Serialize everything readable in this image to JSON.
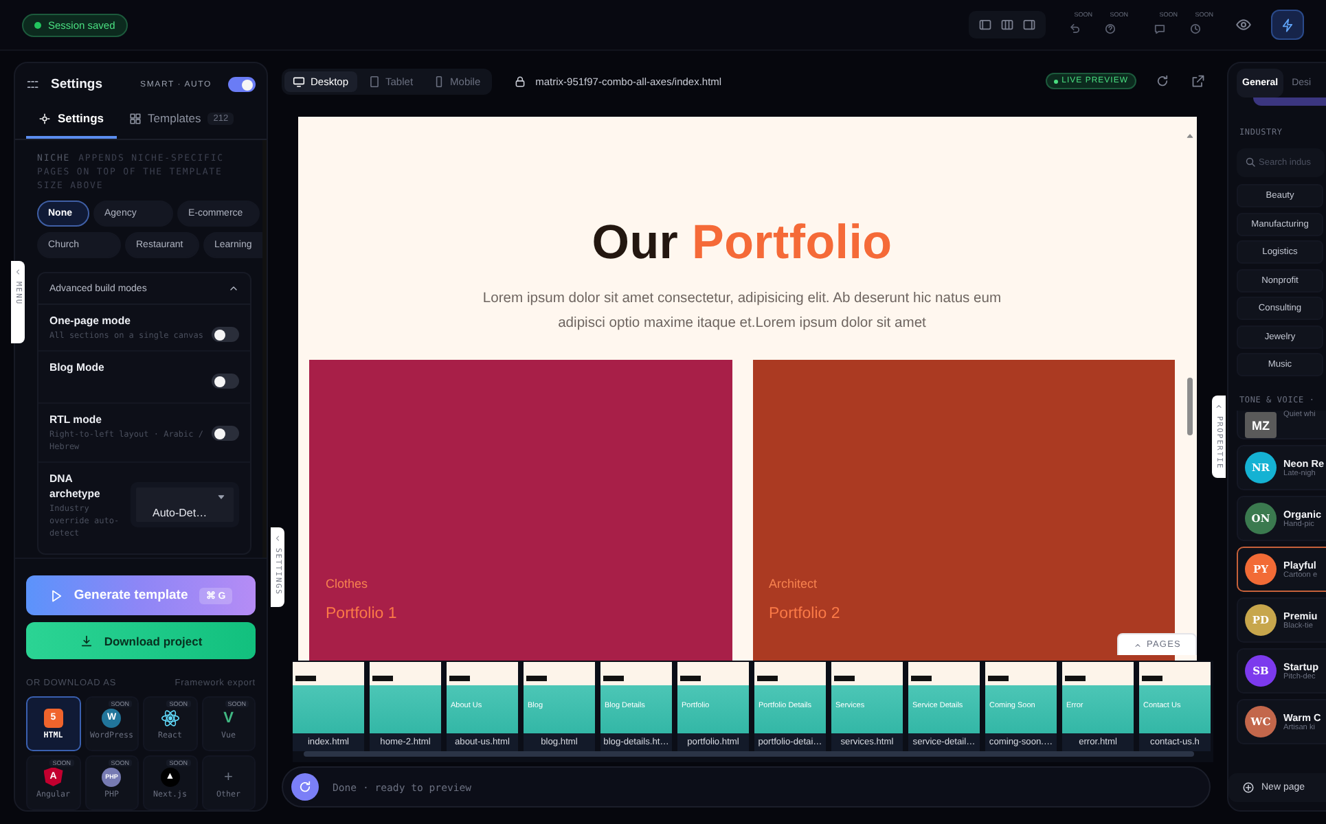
{
  "top_bar": {
    "session_status": "Session saved",
    "tools": [
      {
        "badge": "SOON"
      },
      {
        "badge": "SOON"
      },
      {
        "badge": "SOON"
      },
      {
        "badge": "SOON"
      }
    ]
  },
  "side_tabs": {
    "menu": "MENU",
    "settings": "SETTINGS",
    "properties": "PROPERTIE"
  },
  "settings_panel": {
    "title": "Settings",
    "mode_label": "SMART · AUTO",
    "mode_on": true,
    "tabs": [
      {
        "label": "Settings",
        "selected": true
      },
      {
        "label": "Templates",
        "count": "212",
        "selected": false
      }
    ],
    "niche": {
      "label": "NICHE",
      "hint": "APPENDS NICHE-SPECIFIC PAGES ON TOP OF THE TEMPLATE SIZE ABOVE",
      "options": [
        {
          "label": "None",
          "selected": true
        },
        {
          "label": "Agency",
          "selected": false
        },
        {
          "label": "E-commerce",
          "selected": false
        },
        {
          "label": "Church",
          "selected": false
        },
        {
          "label": "Restaurant",
          "selected": false
        },
        {
          "label": "Learning",
          "selected": false
        }
      ]
    },
    "advanced": {
      "title": "Advanced build modes",
      "expanded": true,
      "modes": [
        {
          "kind": "toggle",
          "label": "One-page mode",
          "description": "All sections on a single canvas",
          "on": false
        },
        {
          "kind": "toggle",
          "label": "Blog Mode",
          "on": false
        },
        {
          "kind": "toggle",
          "label": "RTL mode",
          "description": "Right-to-left layout · Arabic / Hebrew",
          "on": false
        },
        {
          "kind": "select",
          "label": "DNA archetype",
          "description": "Industry override auto-detect",
          "value": "Auto-Det…"
        }
      ]
    },
    "generate": {
      "label": "Generate template",
      "shortcut": "⌘ G"
    },
    "download": {
      "label": "Download project"
    },
    "export": {
      "label": "OR DOWNLOAD AS",
      "note": "Framework export",
      "formats": [
        {
          "label": "HTML",
          "kind": "square",
          "glyph": "5",
          "color": "#f0642c",
          "selected": true
        },
        {
          "label": "WordPress",
          "kind": "circle",
          "glyph": "W",
          "color": "#21759b",
          "badge": "SOON",
          "selected": false
        },
        {
          "label": "React",
          "kind": "atom",
          "color": "#61dafb",
          "badge": "SOON",
          "selected": false
        },
        {
          "label": "Vue",
          "kind": "letter",
          "glyph": "V",
          "color": "#41b883",
          "badge": "SOON",
          "selected": false
        },
        {
          "label": "Angular",
          "kind": "shield",
          "glyph": "A",
          "color": "#c3002f",
          "badge": "SOON",
          "selected": false
        },
        {
          "label": "PHP",
          "kind": "circle",
          "glyph": "PHP",
          "color": "#777bb3",
          "badge": "SOON",
          "selected": false
        },
        {
          "label": "Next.js",
          "kind": "circle",
          "glyph": "▲",
          "color": "#000000",
          "badge": "SOON",
          "selected": false
        },
        {
          "label": "Other",
          "kind": "plus",
          "glyph": "+",
          "color": "#6b7280",
          "selected": false
        }
      ]
    }
  },
  "preview": {
    "device_tabs": [
      {
        "label": "Desktop",
        "selected": true
      },
      {
        "label": "Tablet",
        "selected": false
      },
      {
        "label": "Mobile",
        "selected": false
      }
    ],
    "url": "matrix-951f97-combo-all-axes/index.html",
    "live_badge": "LIVE PREVIEW",
    "page": {
      "heading_lead": "Our",
      "heading_accent": "Portfolio",
      "intro": "Lorem ipsum dolor sit amet consectetur, adipisicing elit. Ab deserunt hic natus eum adipisci optio maxime itaque et.Lorem ipsum dolor sit amet",
      "cards": [
        {
          "category": "Clothes",
          "title": "Portfolio 1",
          "color": "#a81f48"
        },
        {
          "category": "Architect",
          "title": "Portfolio 2",
          "color": "#ab3a22"
        }
      ]
    },
    "pages_button": "PAGES",
    "pages": [
      {
        "file": "index.html"
      },
      {
        "file": "home-2.html"
      },
      {
        "file": "about-us.html",
        "title": "About Us"
      },
      {
        "file": "blog.html",
        "title": "Blog"
      },
      {
        "file": "blog-details.ht…",
        "title": "Blog Details"
      },
      {
        "file": "portfolio.html",
        "title": "Portfolio"
      },
      {
        "file": "portfolio-detai…",
        "title": "Portfolio Details"
      },
      {
        "file": "services.html",
        "title": "Services"
      },
      {
        "file": "service-detail…",
        "title": "Service Details"
      },
      {
        "file": "coming-soon.…",
        "title": "Coming Soon"
      },
      {
        "file": "error.html",
        "title": "Error"
      },
      {
        "file": "contact-us.h",
        "title": "Contact Us"
      }
    ],
    "status": "Done · ready to preview"
  },
  "properties_panel": {
    "tabs": [
      {
        "label": "General",
        "selected": true
      },
      {
        "label": "Desi",
        "selected": false
      }
    ],
    "industry_label": "INDUSTRY",
    "search": {
      "placeholder": "Search indus"
    },
    "industries": [
      "Beauty",
      "Manufacturing",
      "Logistics",
      "Nonprofit",
      "Consulting",
      "Jewelry",
      "Music"
    ],
    "tone_label": "TONE & VOICE ·",
    "voices": [
      {
        "initials": "MZ",
        "subtitle": "Quiet whi",
        "color": "#5a5a5a",
        "selected": false
      },
      {
        "initials": "NR",
        "name": "Neon Re",
        "subtitle": "Late-nigh",
        "color": "#15b2d3",
        "selected": false
      },
      {
        "initials": "ON",
        "name": "Organic",
        "subtitle": "Hand-pic",
        "color": "#3b7a4f",
        "selected": false
      },
      {
        "initials": "PY",
        "name": "Playful",
        "subtitle": "Cartoon e",
        "color": "#f26b36",
        "selected": true
      },
      {
        "initials": "PD",
        "name": "Premiu",
        "subtitle": "Black-tie",
        "color": "#c7a64c",
        "selected": false
      },
      {
        "initials": "SB",
        "name": "Startup",
        "subtitle": "Pitch-dec",
        "color": "#7c3aed",
        "selected": false
      },
      {
        "initials": "WC",
        "name": "Warm C",
        "subtitle": "Artisan ki",
        "color": "#c3674b",
        "selected": false
      }
    ],
    "new_page": "New page"
  }
}
